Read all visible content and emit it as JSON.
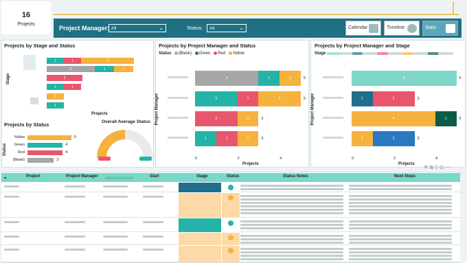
{
  "kpi": {
    "value": "16",
    "label": "Projects"
  },
  "filters": {
    "pm_label": "Project Manager:",
    "pm_value": "All",
    "status_label": "Status:",
    "status_value": "All"
  },
  "nav": {
    "calendar": "Calendar",
    "timeline": "Timeline",
    "stats": "Stats"
  },
  "panels": {
    "stage_status": {
      "title": "Projects by Stage and Status",
      "ylabel": "Stage",
      "xlabel": "Projects"
    },
    "by_status": {
      "title": "Projects by Status",
      "ylabel": "Status"
    },
    "gauge": {
      "title": "Overall Average Status"
    },
    "pm_status": {
      "title": "Projects by Project Manager and Status",
      "ylabel": "Project Manager",
      "xlabel": "Projects",
      "legend_title": "Status",
      "legend": [
        "(Blank)",
        "Green",
        "Red",
        "Yellow"
      ]
    },
    "pm_stage": {
      "title": "Projects by Project Manager and Stage",
      "ylabel": "Project Manager",
      "xlabel": "Projects",
      "legend_title": "Stage"
    }
  },
  "colors": {
    "gray": "#a6a6a6",
    "green": "#24b3a6",
    "teal": "#1f6e8c",
    "red": "#e8566e",
    "yellow": "#f5b23c",
    "dark": "#0b5c47",
    "blue": "#2b78c2",
    "mint": "#7ed6c8",
    "header": "#1f7082"
  },
  "chart_data": [
    {
      "type": "bar",
      "title": "Projects by Stage and Status",
      "xlabel": "Projects",
      "ylabel": "Stage",
      "rows": [
        {
          "segments": [
            {
              "status": "Green",
              "value": 1
            },
            {
              "status": "Red",
              "value": 1
            },
            {
              "status": "Yellow",
              "value": 3
            }
          ]
        },
        {
          "segments": [
            {
              "status": "(Blank)",
              "value": 2
            },
            {
              "status": "Green",
              "value": 1
            },
            {
              "status": "Yellow",
              "value": 1
            }
          ]
        },
        {
          "segments": [
            {
              "status": "Red",
              "value": 2
            }
          ]
        },
        {
          "segments": [
            {
              "status": "Green",
              "value": 1
            },
            {
              "status": "Red",
              "value": 1
            }
          ]
        },
        {
          "segments": [
            {
              "status": "Yellow",
              "value": 1
            }
          ]
        },
        {
          "segments": [
            {
              "status": "Green",
              "value": 1
            }
          ]
        }
      ]
    },
    {
      "type": "bar",
      "title": "Projects by Status",
      "ylabel": "Status",
      "categories": [
        "Yellow",
        "Green",
        "Red",
        "(Blank)"
      ],
      "values": [
        5,
        4,
        4,
        3
      ]
    },
    {
      "type": "bar",
      "title": "Projects by Project Manager and Status",
      "xlabel": "Projects",
      "ylabel": "Project Manager",
      "xticks": [
        "0",
        "2",
        "4"
      ],
      "rows": [
        {
          "total": 5,
          "segments": [
            {
              "status": "(Blank)",
              "value": 3
            },
            {
              "status": "Green",
              "value": 1
            },
            {
              "status": "Yellow",
              "value": 1
            }
          ]
        },
        {
          "total": 5,
          "segments": [
            {
              "status": "Green",
              "value": 2
            },
            {
              "status": "Red",
              "value": 1
            },
            {
              "status": "Yellow",
              "value": 2
            }
          ]
        },
        {
          "total": 3,
          "segments": [
            {
              "status": "Red",
              "value": 2
            },
            {
              "status": "Yellow",
              "value": 1
            }
          ]
        },
        {
          "total": 3,
          "segments": [
            {
              "status": "Green",
              "value": 1
            },
            {
              "status": "Red",
              "value": 1
            },
            {
              "status": "Yellow",
              "value": 1
            }
          ]
        }
      ]
    },
    {
      "type": "bar",
      "title": "Projects by Project Manager and Stage",
      "xlabel": "Projects",
      "ylabel": "Project Manager",
      "xticks": [
        "0",
        "2",
        "4"
      ],
      "rows": [
        {
          "total": 5,
          "segments": [
            {
              "color": "mint",
              "value": 5
            }
          ]
        },
        {
          "total": 3,
          "segments": [
            {
              "color": "teal",
              "value": 1
            },
            {
              "color": "red",
              "value": 2
            }
          ]
        },
        {
          "total": 5,
          "segments": [
            {
              "color": "yellow",
              "value": 4
            },
            {
              "color": "dark",
              "value": 1
            }
          ]
        },
        {
          "total": 3,
          "segments": [
            {
              "color": "yellow",
              "value": 1
            },
            {
              "color": "blue",
              "value": 2
            }
          ]
        }
      ]
    }
  ],
  "table": {
    "headers": [
      "Project",
      "Project Manager",
      "",
      "Start",
      "Stage",
      "Status",
      "Status Notes",
      "Next Steps"
    ],
    "visible_headers": [
      "Project",
      "Project Manager",
      "Start",
      "Stage",
      "Status",
      "Status Notes",
      "Next Steps"
    ]
  }
}
